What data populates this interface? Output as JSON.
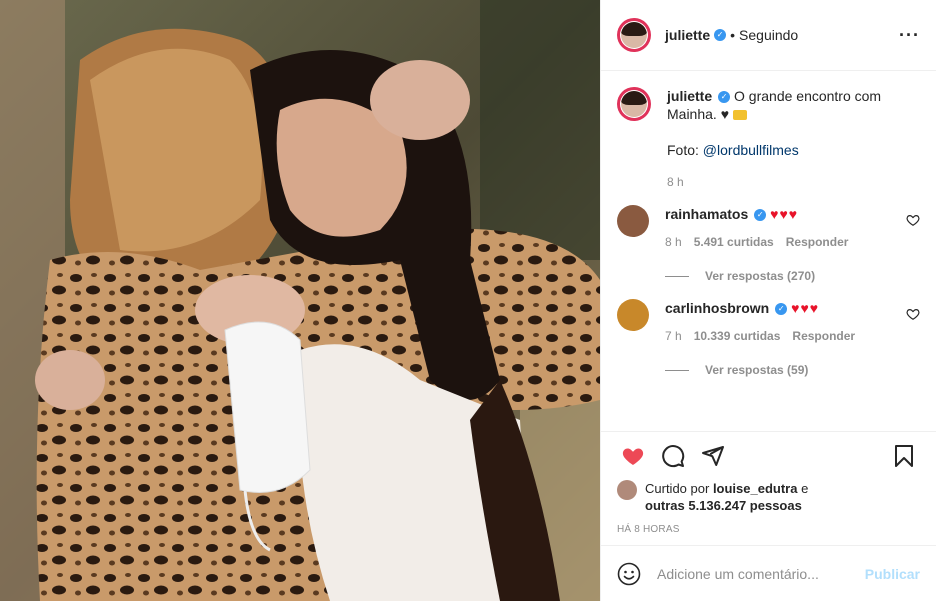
{
  "post": {
    "author": {
      "username": "juliette",
      "verified_icon": "verified-badge-icon",
      "follow_status": "Seguindo"
    },
    "photo_alt": "photo-two-women-hugging"
  },
  "caption": {
    "username": "juliette",
    "text": "O grande encontro com Mainha. ♥",
    "credit_prefix": "Foto:",
    "credit_handle": "@lordbullfilmes",
    "time": "8 h"
  },
  "comments": [
    {
      "username": "rainhamatos",
      "text": "♥♥♥",
      "time": "8 h",
      "likes": "5.491 curtidas",
      "reply_label": "Responder",
      "view_replies": "Ver respostas (270)"
    },
    {
      "username": "carlinhosbrown",
      "text": "♥♥♥",
      "time": "7 h",
      "likes": "10.339 curtidas",
      "reply_label": "Responder",
      "view_replies": "Ver respostas (59)"
    }
  ],
  "engagement": {
    "liked_prefix": "Curtido por",
    "liked_user": "louise_edutra",
    "liked_and": "e",
    "liked_others": "outras 5.136.247 pessoas",
    "timestamp": "HÁ 8 HORAS"
  },
  "comment_box": {
    "placeholder": "Adicione um comentário...",
    "publish_label": "Publicar"
  },
  "colors": {
    "heart_red": "#ed4956",
    "link_blue": "#00376b",
    "verified_blue": "#3897f0",
    "publish_disabled": "#b2dffc"
  }
}
